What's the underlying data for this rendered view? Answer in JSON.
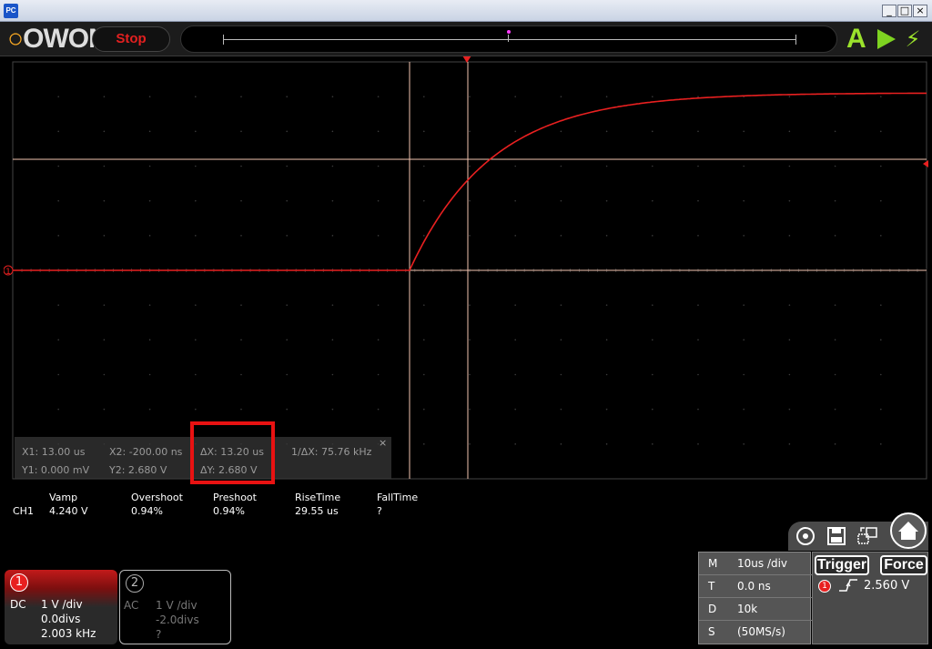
{
  "window": {
    "icon_label": "PC",
    "minimize": "_",
    "maximize": "□",
    "close": "×"
  },
  "toolbar": {
    "logo_text": "OWON",
    "run_state": "Stop",
    "icons": [
      "auto-icon",
      "run-icon",
      "force-trigger-icon"
    ],
    "auto_label": "A",
    "force_glyph": "⚡",
    "colors": {
      "logo_accent": "#f5a623",
      "stop": "#e32020",
      "run": "#7ed321"
    }
  },
  "scope": {
    "channel_marker": "1",
    "trace_color": "#e82020",
    "cursor_color": "#f2c4b0"
  },
  "cursor_readout": {
    "x1": "X1: 13.00 us",
    "x2": "X2: -200.00 ns",
    "dx": "ΔX: 13.20 us",
    "inv_dx": "1/ΔX: 75.76 kHz",
    "y1": "Y1: 0.000 mV",
    "y2": "Y2: 2.680 V",
    "dy": "ΔY: 2.680 V",
    "close": "×"
  },
  "measurements": {
    "headers": [
      "Vamp",
      "Overshoot",
      "Preshoot",
      "RiseTime",
      "FallTime"
    ],
    "rows": [
      {
        "channel": "CH1",
        "values": [
          "4.240 V",
          "0.94%",
          "0.94%",
          "29.55 us",
          "?"
        ]
      }
    ]
  },
  "icon_bar": [
    "screenshot-icon",
    "save-icon",
    "swap-icon",
    "home-icon"
  ],
  "channels": [
    {
      "num": "1",
      "coupling": "DC",
      "scale": "1 V /div",
      "offset": "0.0divs",
      "freq": "2.003 kHz"
    },
    {
      "num": "2",
      "coupling": "AC",
      "scale": "1 V /div",
      "offset": "-2.0divs",
      "freq": "?"
    }
  ],
  "timebase": [
    {
      "key": "M",
      "value": "10us /div"
    },
    {
      "key": "T",
      "value": "0.0 ns"
    },
    {
      "key": "D",
      "value": "10k"
    },
    {
      "key": "S",
      "value": "(50MS/s)"
    }
  ],
  "trigger": {
    "trigger_label": "Trigger",
    "force_label": "Force",
    "channel": "1",
    "edge": "rising-edge-icon",
    "level": "2.560 V"
  }
}
